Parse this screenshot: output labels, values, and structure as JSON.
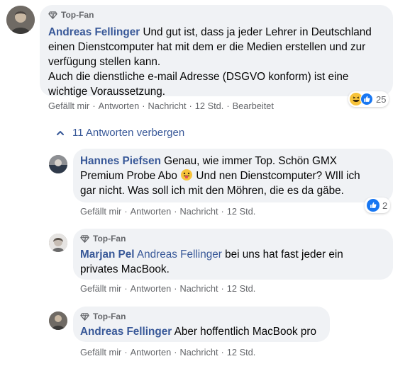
{
  "comment": {
    "badge": "Top-Fan",
    "author": "Andreas Fellinger",
    "text_line1": "Und gut ist, dass ja jeder Lehrer in Deutschland",
    "text_line2": "einen Dienstcomputer hat mit dem er die Medien erstellen und zur",
    "text_line3": "verfügung stellen kann.",
    "text_line4": "Auch die dienstliche e-mail Adresse (DSGVO konform) ist eine",
    "text_line5": "wichtige Voraussetzung.",
    "reaction_count": "25",
    "actions": {
      "like": "Gefällt mir",
      "reply": "Antworten",
      "message": "Nachricht",
      "time": "12 Std.",
      "edited": "Bearbeitet"
    }
  },
  "replies_toggle": "11 Antworten verbergen",
  "replies": [
    {
      "author": "Hannes Piefsen",
      "text_line1": "Genau, wie immer Top. Schön GMX",
      "text_line2a": "Premium Probe Abo",
      "text_line2b": "Und nen Dienstcomputer? WIll ich",
      "text_line3": "gar nicht. Was soll ich mit den Möhren, die es da gäbe.",
      "reaction_count": "2",
      "actions": {
        "like": "Gefällt mir",
        "reply": "Antworten",
        "message": "Nachricht",
        "time": "12 Std."
      }
    },
    {
      "badge": "Top-Fan",
      "author": "Marjan Pel",
      "mention": "Andreas Fellinger",
      "text_line1": "bei uns hat fast jeder ein",
      "text_line2": "privates MacBook.",
      "actions": {
        "like": "Gefällt mir",
        "reply": "Antworten",
        "message": "Nachricht",
        "time": "12 Std."
      }
    },
    {
      "badge": "Top-Fan",
      "author": "Andreas Fellinger",
      "text_line1": "Aber hoffentlich MacBook pro",
      "actions": {
        "like": "Gefällt mir",
        "reply": "Antworten",
        "message": "Nachricht",
        "time": "12 Std."
      }
    }
  ],
  "colors": {
    "author": "#385898",
    "bubble": "#f0f2f5",
    "meta": "#65676b",
    "like_blue": "#1877f2"
  },
  "icons": [
    "diamond-icon",
    "haha-reaction-icon",
    "like-reaction-icon",
    "chevron-up-icon",
    "tongue-emoji-icon"
  ]
}
